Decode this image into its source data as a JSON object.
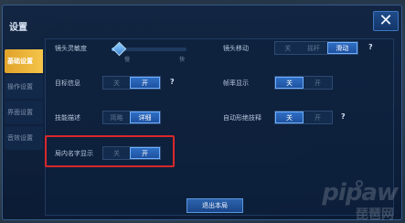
{
  "title": "设置",
  "close_glyph": "✕",
  "sidebar": {
    "items": [
      {
        "label": "基础设置",
        "active": true
      },
      {
        "label": "操作设置",
        "active": false
      },
      {
        "label": "界面设置",
        "active": false
      },
      {
        "label": "音效设置",
        "active": false
      }
    ]
  },
  "settings": {
    "camera_sensitivity": {
      "label": "镜头灵敏度",
      "min": "慢",
      "max": "快",
      "level": 0.1
    },
    "camera_move": {
      "label": "镜头移动",
      "options": [
        "关",
        "摇杆",
        "滑动"
      ],
      "selected": "滑动",
      "help": "?"
    },
    "target_info": {
      "label": "目标信息",
      "options": [
        "关",
        "开"
      ],
      "selected": "开",
      "help": "?"
    },
    "frame_rate": {
      "label": "帧率显示",
      "options": [
        "关",
        "开"
      ],
      "selected": "关"
    },
    "skill_desc": {
      "label": "技能描述",
      "options": [
        "简略",
        "详细"
      ],
      "selected": "详细"
    },
    "auto_cast": {
      "label": "自动形绝技释",
      "options": [
        "关",
        "开"
      ],
      "selected": "关",
      "help": "?"
    },
    "name_display": {
      "label": "局内名字显示",
      "options": [
        "关",
        "开"
      ],
      "selected": "开"
    }
  },
  "exit_button": "退出本局",
  "watermark": {
    "logo": "pipaw",
    "sub": "琵琶网"
  },
  "colors": {
    "accent": "#f0b23a",
    "toggle_on": "#2f6ec4",
    "highlight": "#d8282b"
  }
}
